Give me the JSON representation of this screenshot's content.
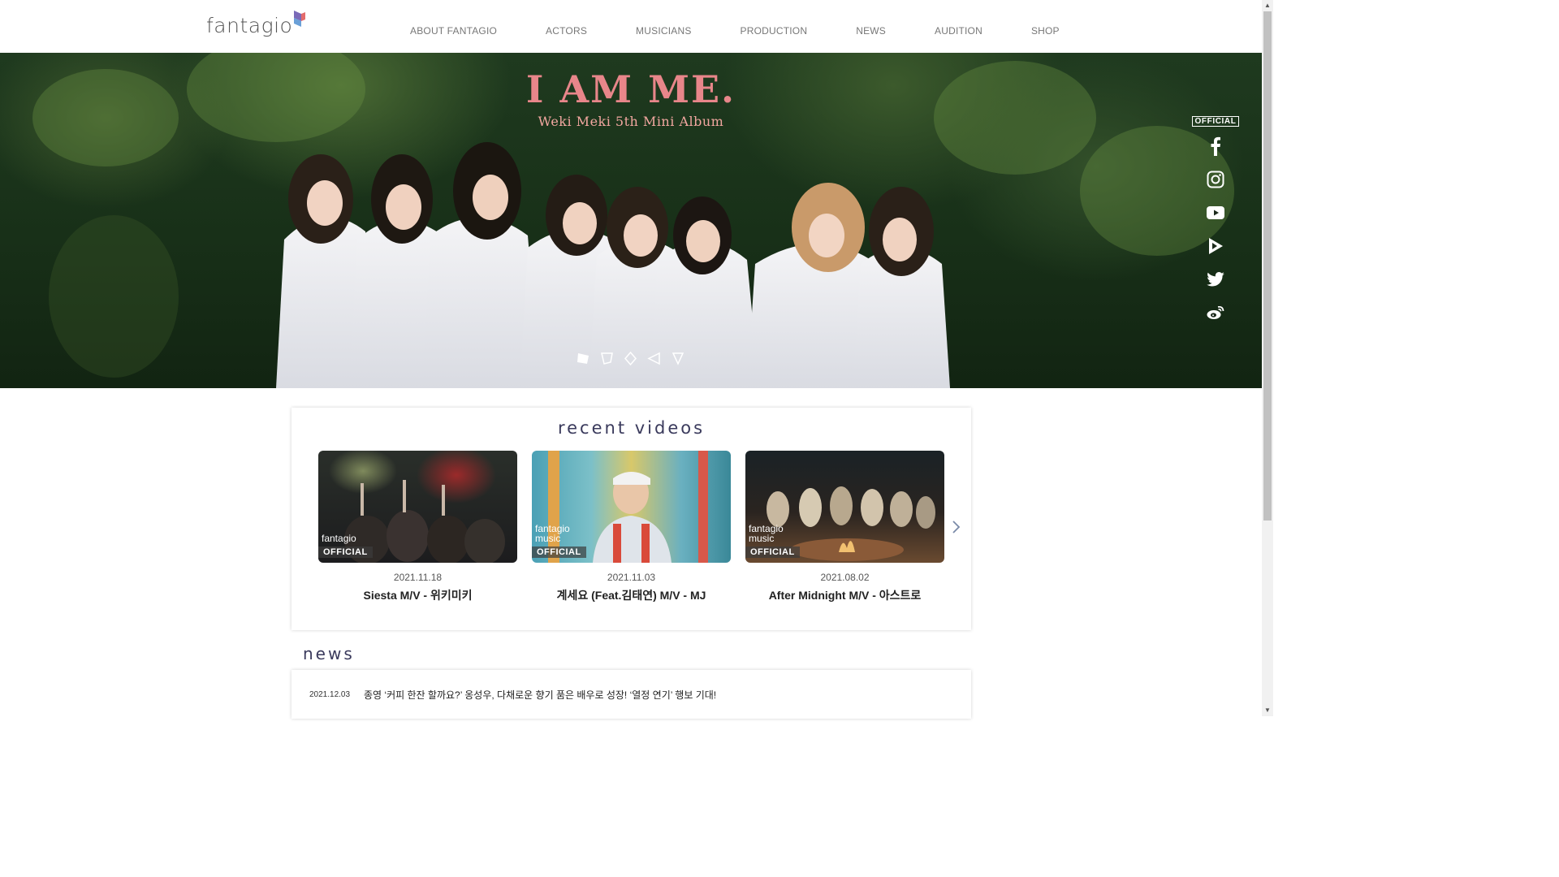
{
  "header": {
    "logo_text": "fantagio",
    "nav": [
      "ABOUT FANTAGIO",
      "ACTORS",
      "MUSICIANS",
      "PRODUCTION",
      "NEWS",
      "AUDITION",
      "SHOP"
    ]
  },
  "hero": {
    "title": "I AM ME.",
    "subtitle": "Weki Meki 5th Mini Album",
    "slide_count": 5,
    "active_slide": 1
  },
  "social": {
    "badge": "OFFICIAL",
    "icons": [
      "facebook-icon",
      "instagram-icon",
      "youtube-icon",
      "play-icon",
      "twitter-icon",
      "weibo-icon"
    ]
  },
  "videos": {
    "heading": "recent videos",
    "items": [
      {
        "date": "2021.11.18",
        "title": "Siesta M/V - 위키미키",
        "brand": "fantagio",
        "badge": "OFFICIAL"
      },
      {
        "date": "2021.11.03",
        "title": "계세요 (Feat.김태연) M/V - MJ",
        "brand": "fantagio\nmusic",
        "badge": "OFFICIAL"
      },
      {
        "date": "2021.08.02",
        "title": "After Midnight M/V - 아스트로",
        "brand": "fantagio\nmusic",
        "badge": "OFFICIAL"
      }
    ]
  },
  "news": {
    "heading": "news",
    "items": [
      {
        "date": "2021.12.03",
        "text": "종영 ‘커피 한잔 할까요?’ 옹성우, 다채로운 향기 품은 배우로 성장! ‘열정 연기’ 행보 기대!"
      }
    ]
  },
  "colors": {
    "hero_title": "#e8868a",
    "heading": "#3a3a5c",
    "nav_text": "#777777"
  }
}
